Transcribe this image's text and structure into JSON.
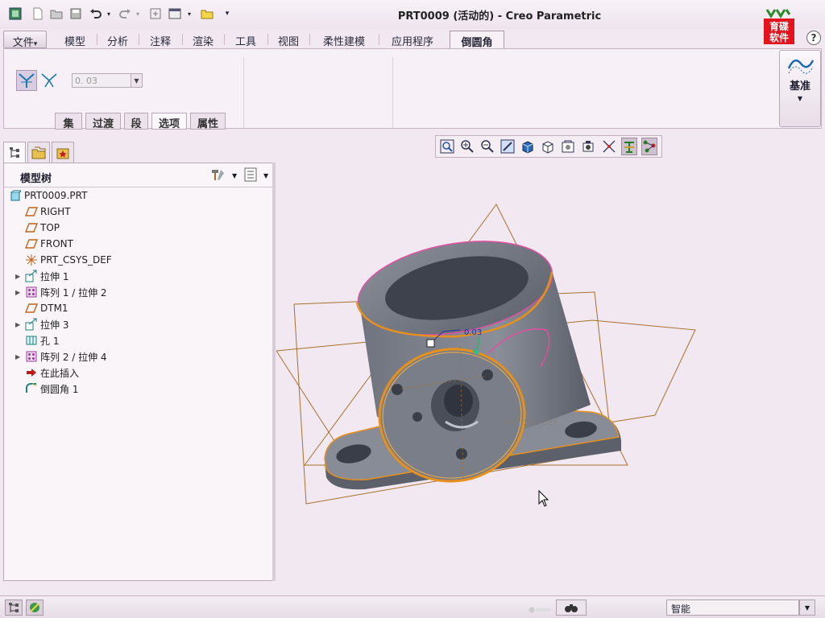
{
  "window": {
    "title": "PRT0009 (活动的) - Creo Parametric"
  },
  "quick_access": [
    "app-icon",
    "new-icon",
    "open-icon",
    "save-icon",
    "undo-icon",
    "redo-icon",
    "regenerate-icon",
    "windows-icon",
    "close-window-icon",
    "customize-icon"
  ],
  "ribbon_tabs": [
    {
      "label": "文件",
      "dropdown": "▾"
    },
    {
      "label": "模型"
    },
    {
      "label": "分析"
    },
    {
      "label": "注释"
    },
    {
      "label": "渲染"
    },
    {
      "label": "工具"
    },
    {
      "label": "视图"
    },
    {
      "label": "柔性建模"
    },
    {
      "label": "应用程序"
    },
    {
      "label": "倒圆角",
      "active": true
    }
  ],
  "ribbon": {
    "radius_value": "0. 03",
    "subtabs": [
      {
        "label": "集"
      },
      {
        "label": "过渡"
      },
      {
        "label": "段"
      },
      {
        "label": "选项",
        "active": true
      },
      {
        "label": "属性"
      }
    ],
    "datum_label": "基准"
  },
  "logo": {
    "text_line1": "育碟",
    "text_line2": "软件",
    "color": "#e3141e"
  },
  "model_tree": {
    "title": "模型树",
    "items": [
      {
        "label": "PRT0009.PRT",
        "icon": "part-icon",
        "expandable": false,
        "level": 0
      },
      {
        "label": "RIGHT",
        "icon": "datum-plane-icon",
        "expandable": false,
        "level": 1
      },
      {
        "label": "TOP",
        "icon": "datum-plane-icon",
        "expandable": false,
        "level": 1
      },
      {
        "label": "FRONT",
        "icon": "datum-plane-icon",
        "expandable": false,
        "level": 1
      },
      {
        "label": "PRT_CSYS_DEF",
        "icon": "csys-icon",
        "expandable": false,
        "level": 1
      },
      {
        "label": "拉伸 1",
        "icon": "extrude-icon",
        "expandable": true,
        "level": 1
      },
      {
        "label": "阵列 1 / 拉伸 2",
        "icon": "pattern-icon",
        "expandable": true,
        "level": 1
      },
      {
        "label": "DTM1",
        "icon": "datum-plane-icon",
        "expandable": false,
        "level": 1
      },
      {
        "label": "拉伸 3",
        "icon": "extrude-icon",
        "expandable": true,
        "level": 1
      },
      {
        "label": "孔 1",
        "icon": "hole-icon",
        "expandable": false,
        "level": 1
      },
      {
        "label": "阵列 2 / 拉伸 4",
        "icon": "pattern-icon",
        "expandable": true,
        "level": 1
      },
      {
        "label": "在此插入",
        "icon": "insert-here-arrow-icon",
        "expandable": false,
        "level": 1
      },
      {
        "label": "倒圆角 1",
        "icon": "round-icon",
        "expandable": false,
        "level": 1
      }
    ]
  },
  "viewport": {
    "dimension_label": "0.03",
    "csys_label": "PRT_CSYS_DEF"
  },
  "status_bar": {
    "filter_value": "智能"
  },
  "colors": {
    "background": "#f1e8f1",
    "edge_highlight": "#e8901c",
    "datum_plane": "#a8702c",
    "model_gray": "#6a6e78"
  }
}
